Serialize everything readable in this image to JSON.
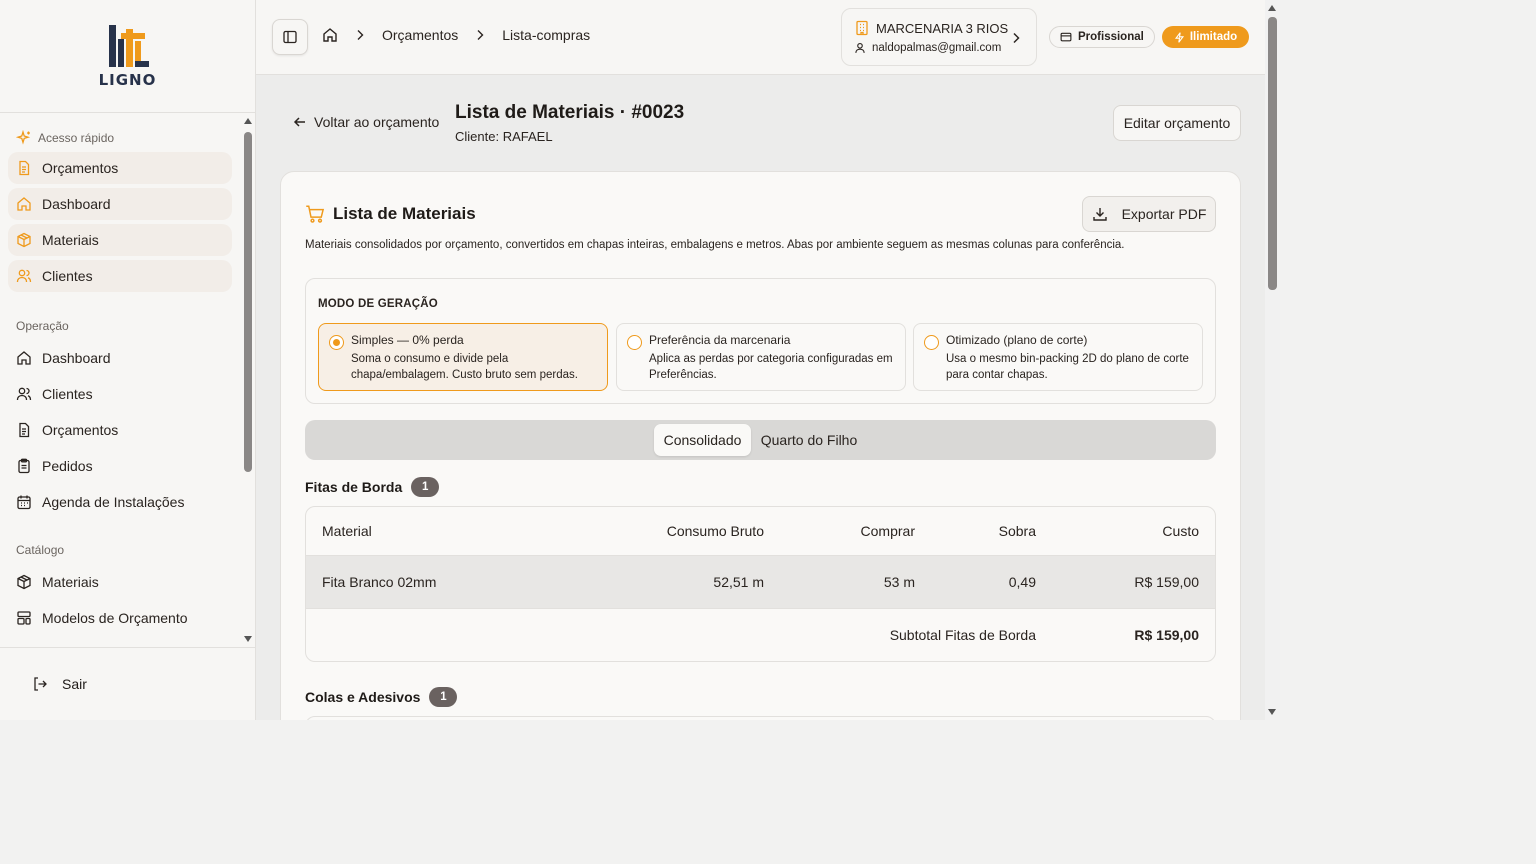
{
  "brand": {
    "name": "LIGNO",
    "accent": "#ef9a1c",
    "navy": "#27324a"
  },
  "sidebar": {
    "quick_access": {
      "title": "Acesso rápido",
      "items": [
        {
          "label": "Orçamentos",
          "icon": "file-text-icon"
        },
        {
          "label": "Dashboard",
          "icon": "home-icon"
        },
        {
          "label": "Materiais",
          "icon": "package-icon"
        },
        {
          "label": "Clientes",
          "icon": "users-icon"
        }
      ]
    },
    "operation": {
      "title": "Operação",
      "items": [
        {
          "label": "Dashboard",
          "icon": "home-icon"
        },
        {
          "label": "Clientes",
          "icon": "users-icon"
        },
        {
          "label": "Orçamentos",
          "icon": "file-text-icon"
        },
        {
          "label": "Pedidos",
          "icon": "clipboard-icon"
        },
        {
          "label": "Agenda de Instalações",
          "icon": "calendar-icon"
        }
      ]
    },
    "catalog": {
      "title": "Catálogo",
      "items": [
        {
          "label": "Materiais",
          "icon": "package-icon"
        },
        {
          "label": "Modelos de Orçamento",
          "icon": "layout-template-icon"
        }
      ]
    },
    "logout_label": "Sair"
  },
  "topbar": {
    "breadcrumbs": [
      "Orçamentos",
      "Lista-compras"
    ],
    "company": {
      "name": "MARCENARIA 3 RIOS",
      "email": "naldopalmas@gmail.com"
    },
    "plan_label": "Profissional",
    "limit_label": "Ilimitado"
  },
  "header": {
    "back_label": "Voltar ao orçamento",
    "title": "Lista de Materiais · #0023",
    "client": "Cliente: RAFAEL",
    "edit_label": "Editar orçamento"
  },
  "card": {
    "title": "Lista de Materiais",
    "description": "Materiais consolidados por orçamento, convertidos em chapas inteiras, embalagens e metros. Abas por ambiente seguem as mesmas colunas para conferência.",
    "export_label": "Exportar PDF",
    "mode": {
      "label": "MODO DE GERAÇÃO",
      "options": [
        {
          "title": "Simples — 0% perda",
          "desc": "Soma o consumo e divide pela chapa/embalagem. Custo bruto sem perdas.",
          "selected": true
        },
        {
          "title": "Preferência da marcenaria",
          "desc": "Aplica as perdas por categoria configuradas em Preferências.",
          "selected": false
        },
        {
          "title": "Otimizado (plano de corte)",
          "desc": "Usa o mesmo bin-packing 2D do plano de corte para contar chapas.",
          "selected": false
        }
      ]
    },
    "tabs": [
      {
        "label": "Consolidado",
        "active": true
      },
      {
        "label": "Quarto do Filho",
        "active": false
      }
    ],
    "groups": [
      {
        "title": "Fitas de Borda",
        "count": "1",
        "columns": [
          "Material",
          "Consumo Bruto",
          "Comprar",
          "Sobra",
          "Custo"
        ],
        "rows": [
          {
            "material": "Fita Branco 02mm",
            "consumo": "52,51 m",
            "comprar": "53 m",
            "sobra": "0,49",
            "custo": "R$ 159,00"
          }
        ],
        "subtotal_label": "Subtotal Fitas de Borda",
        "subtotal_value": "R$ 159,00"
      },
      {
        "title": "Colas e Adesivos",
        "count": "1"
      }
    ]
  }
}
